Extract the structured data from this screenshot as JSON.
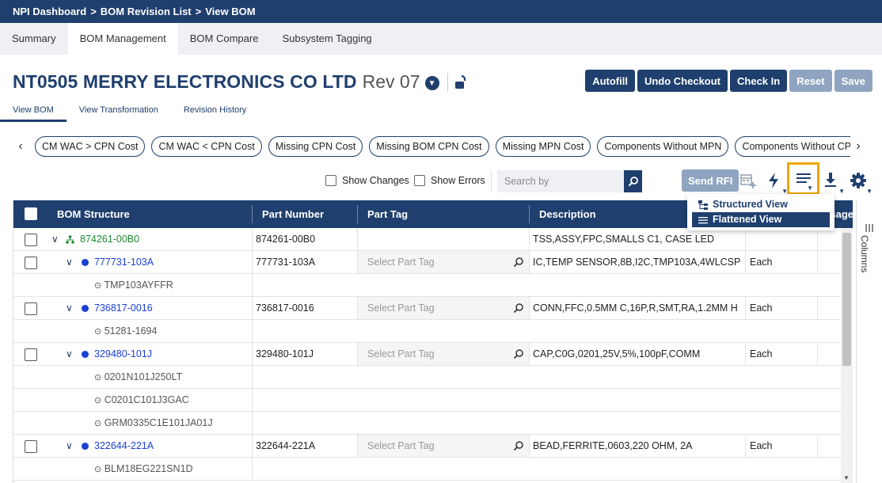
{
  "breadcrumb": [
    "NPI Dashboard",
    "BOM Revision List",
    "View BOM"
  ],
  "breadcrumb_sep": ">",
  "tabs": [
    {
      "label": "Summary",
      "active": false
    },
    {
      "label": "BOM Management",
      "active": true
    },
    {
      "label": "BOM Compare",
      "active": false
    },
    {
      "label": "Subsystem Tagging",
      "active": false
    }
  ],
  "header": {
    "supplier": "NT0505 MERRY ELECTRONICS CO LTD",
    "revision": "Rev 07"
  },
  "actions": [
    {
      "label": "Autofill",
      "enabled": true
    },
    {
      "label": "Undo Checkout",
      "enabled": true
    },
    {
      "label": "Check In",
      "enabled": true
    },
    {
      "label": "Reset",
      "enabled": false
    },
    {
      "label": "Save",
      "enabled": false
    }
  ],
  "subtabs": [
    {
      "label": "View BOM",
      "active": true
    },
    {
      "label": "View Transformation",
      "active": false
    },
    {
      "label": "Revision History",
      "active": false
    }
  ],
  "filter_chips": [
    "CM WAC > CPN Cost",
    "CM WAC < CPN Cost",
    "Missing CPN Cost",
    "Missing BOM CPN Cost",
    "Missing MPN Cost",
    "Components Without MPN",
    "Components Without CPN"
  ],
  "toolbar": {
    "show_changes": "Show Changes",
    "show_errors": "Show Errors",
    "search_placeholder": "Search by",
    "send_rfi": "Send RFI"
  },
  "view_menu": {
    "items": [
      {
        "label": "Structured View",
        "icon": "tree-icon",
        "selected": false
      },
      {
        "label": "Flattened View",
        "icon": "list-icon",
        "selected": true
      }
    ]
  },
  "grid": {
    "columns": [
      "BOM Structure",
      "Part Number",
      "Part Tag",
      "Description",
      "Usage"
    ],
    "rows": [
      {
        "kind": "root",
        "name": "874261-00B0",
        "part_number": "874261-00B0",
        "part_tag": "",
        "description": "TSS,ASSY,FPC,SMALLS C1, CASE LED",
        "uom": ""
      },
      {
        "kind": "part",
        "name": "777731-103A",
        "part_number": "777731-103A",
        "part_tag": "Select Part Tag",
        "description": "IC,TEMP SENSOR,8B,I2C,TMP103A,4WLCSP",
        "uom": "Each"
      },
      {
        "kind": "mpn",
        "name": "TMP103AYFFR"
      },
      {
        "kind": "part",
        "name": "736817-0016",
        "part_number": "736817-0016",
        "part_tag": "Select Part Tag",
        "description": "CONN,FFC,0.5MM C,16P,R,SMT,RA,1.2MM H",
        "uom": "Each"
      },
      {
        "kind": "mpn",
        "name": "51281-1694"
      },
      {
        "kind": "part",
        "name": "329480-101J",
        "part_number": "329480-101J",
        "part_tag": "Select Part Tag",
        "description": "CAP,C0G,0201,25V,5%,100pF,COMM",
        "uom": "Each"
      },
      {
        "kind": "mpn",
        "name": "0201N101J250LT"
      },
      {
        "kind": "mpn",
        "name": "C0201C101J3GAC"
      },
      {
        "kind": "mpn",
        "name": "GRM0335C1E101JA01J"
      },
      {
        "kind": "part",
        "name": "322644-221A",
        "part_number": "322644-221A",
        "part_tag": "Select Part Tag",
        "description": "BEAD,FERRITE,0603,220 OHM, 2A",
        "uom": "Each"
      },
      {
        "kind": "mpn",
        "name": "BLM18EG221SN1D"
      }
    ]
  },
  "columns_panel": "Columns",
  "colors": {
    "primary": "#1f3f6e",
    "highlight": "#f0a500",
    "link": "#1a3fd6",
    "root": "#1e8a32"
  }
}
